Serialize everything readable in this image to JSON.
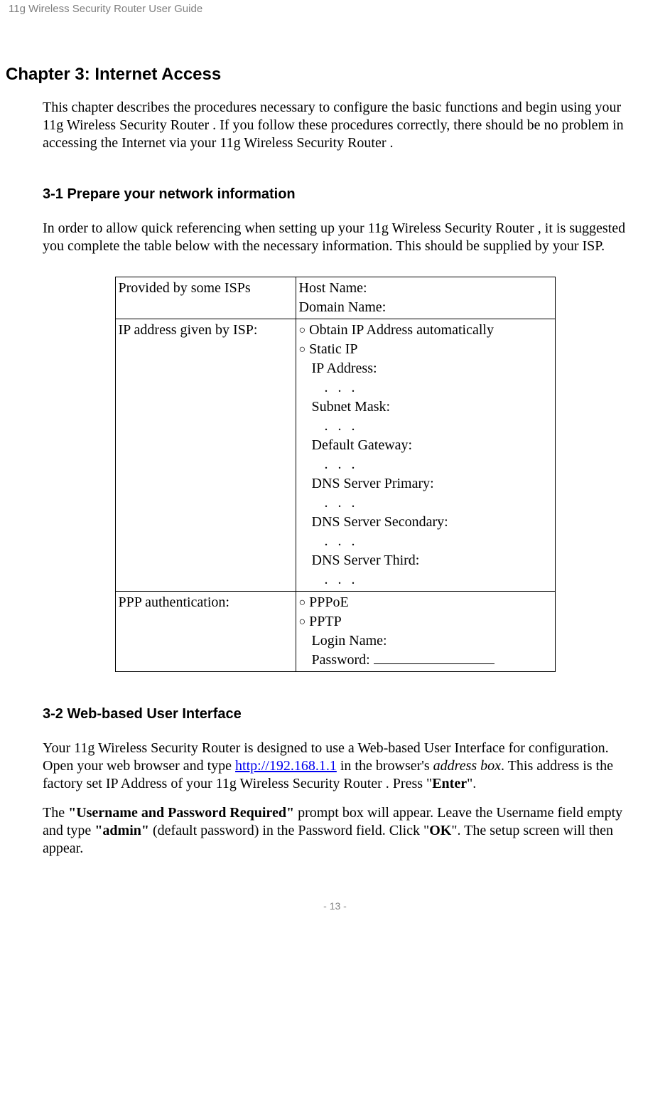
{
  "header": "11g Wireless Security Router User Guide",
  "chapter": "Chapter 3: Internet Access",
  "intro": "This chapter describes the procedures necessary to configure the basic functions and begin using your 11g Wireless Security Router . If you follow these procedures correctly, there should be no problem in accessing the Internet via your 11g Wireless Security Router .",
  "section31_title": "3-1 Prepare your network information",
  "section31_body": "In order to allow quick referencing when setting up your 11g Wireless Security Router , it is suggested you complete the table below with the necessary information. This should be supplied by your ISP.",
  "table": {
    "row1_left": "Provided by some ISPs",
    "row1_right_a": "Host Name:",
    "row1_right_b": "Domain Name:",
    "row2_left": "IP address given by ISP:",
    "row2_opt1": "Obtain IP Address automatically",
    "row2_opt2": "Static IP",
    "row2_l1": "IP Address:",
    "row2_l2": "Subnet Mask:",
    "row2_l3": "Default Gateway:",
    "row2_l4": "DNS Server Primary:",
    "row2_l5": "DNS Server Secondary:",
    "row2_l6": "DNS Server Third:",
    "dots": ".   .   .",
    "row3_left": "PPP authentication:",
    "row3_opt1": "PPPoE",
    "row3_opt2": "PPTP",
    "row3_l1": "Login Name:",
    "row3_l2": "Password: "
  },
  "section32_title": "3-2 Web-based User Interface",
  "section32_body_a": "Your 11g Wireless Security Router  is designed to use a Web-based User Interface for configuration. Open your web browser and type ",
  "router_url": "http://192.168.1.1",
  "section32_body_b": " in the browser's ",
  "section32_body_c": "address box",
  "section32_body_d": ". This address is the factory set IP Address of your 11g Wireless Security Router . Press \"",
  "section32_body_e": "Enter",
  "section32_body_f": "\".",
  "section32_p2_a": "The ",
  "section32_p2_b": "\"Username and Password Required\"",
  "section32_p2_c": " prompt box will appear. Leave the Username field empty and type ",
  "section32_p2_d": "\"admin\"",
  "section32_p2_e": " (default password) in the Password field. Click \"",
  "section32_p2_f": "OK",
  "section32_p2_g": "\". The setup screen will then appear.",
  "footer": "- 13 -",
  "radio_symbol": "〇"
}
